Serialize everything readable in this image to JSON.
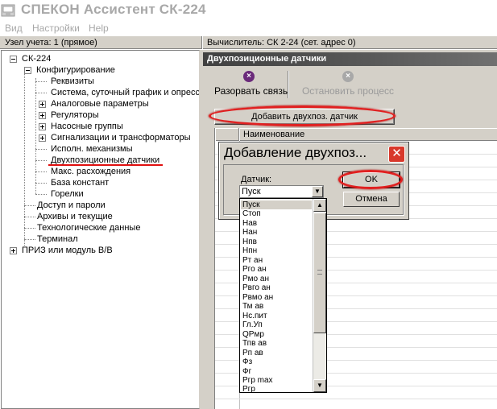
{
  "window": {
    "title": "СПЕКОН Ассистент СК-224",
    "icon": "spekon-app-icon"
  },
  "menu": [
    "Вид",
    "Настройки",
    "Help"
  ],
  "status": {
    "node_account": "Узел учета: 1 (прямое)",
    "calculator": "Вычислитель: СК 2-24 (сет. адрес 0)"
  },
  "tree": [
    {
      "label": "СК-224",
      "expander": "minus"
    },
    {
      "label": "Конфигурирование",
      "expander": "minus"
    },
    {
      "label": "Реквизиты"
    },
    {
      "label": "Система, суточный график и опрессо"
    },
    {
      "label": "Аналоговые параметры",
      "expander": "plus"
    },
    {
      "label": "Регуляторы",
      "expander": "plus"
    },
    {
      "label": "Насосные группы",
      "expander": "plus"
    },
    {
      "label": "Сигнализации и трансформаторы",
      "expander": "plus"
    },
    {
      "label": "Исполн. механизмы"
    },
    {
      "label": "Двухпозиционные датчики",
      "selected": true
    },
    {
      "label": "Макс. расхождения"
    },
    {
      "label": "База констант"
    },
    {
      "label": "Горелки"
    },
    {
      "label": "Доступ и пароли"
    },
    {
      "label": "Архивы и текущие"
    },
    {
      "label": "Технологические данные"
    },
    {
      "label": "Терминал"
    },
    {
      "label": "ПРИЗ или модуль В/В",
      "expander": "plus"
    }
  ],
  "panel": {
    "title": "Двухпозиционные датчики",
    "toolbar": {
      "break_link": "Разорвать связь",
      "stop_process": "Остановить процесс",
      "break_icon": "break-link-icon",
      "stop_icon": "stop-process-icon"
    },
    "add_button": "Добавить двухпоз. датчик",
    "grid_header_name": "Наименование"
  },
  "dialog": {
    "title": "Добавление двухпоз...",
    "sensor_label": "Датчик:",
    "selected_value": "Пуск",
    "ok": "OK",
    "cancel": "Отмена",
    "options": [
      "Пуск",
      "Стоп",
      "Нав",
      "Нан",
      "Нпв",
      "Нпн",
      "Рт ан",
      "Рго ан",
      "Рмо ан",
      "Рвго ан",
      "Рвмо ан",
      "Тм ав",
      "Нс.пит",
      "Гл.Уп",
      "QРмр",
      "Тпв ав",
      "Рп ав",
      "Фз",
      "Фг",
      "Ргр max",
      "Ргр"
    ]
  },
  "accent": {
    "highlight_red": "#e02020",
    "header_dark": "#404040",
    "close_red": "#d8382b"
  }
}
